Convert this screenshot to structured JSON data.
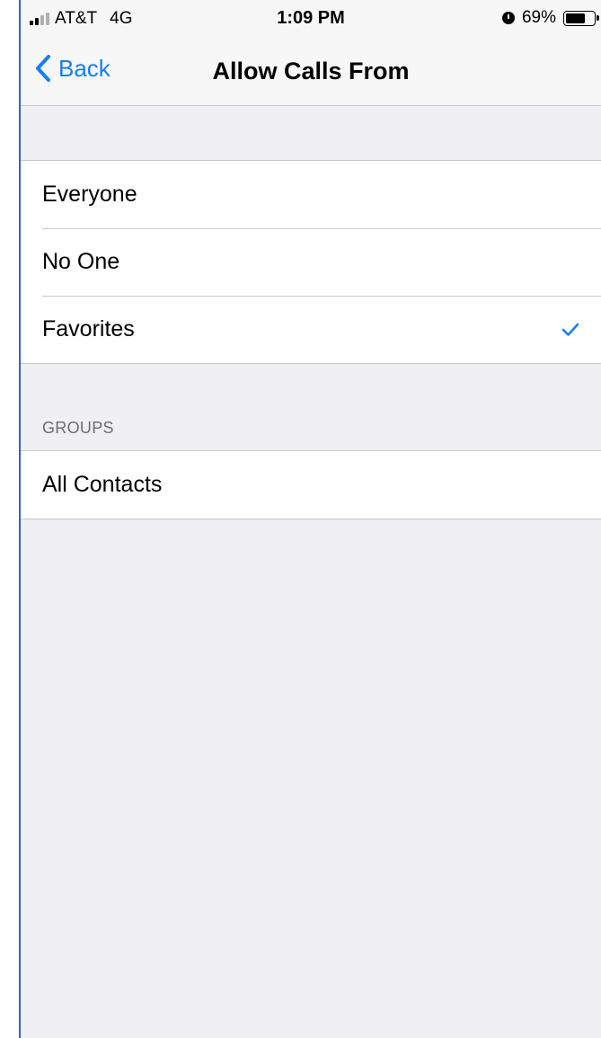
{
  "status_bar": {
    "carrier": "AT&T",
    "network": "4G",
    "time": "1:09 PM",
    "battery_percent": "69%",
    "battery_level": 0.69
  },
  "nav": {
    "back_label": "Back",
    "title": "Allow Calls From"
  },
  "options": {
    "items": [
      {
        "label": "Everyone",
        "selected": false
      },
      {
        "label": "No One",
        "selected": false
      },
      {
        "label": "Favorites",
        "selected": true
      }
    ]
  },
  "groups": {
    "header": "GROUPS",
    "items": [
      {
        "label": "All Contacts"
      }
    ]
  },
  "colors": {
    "accent": "#157efb",
    "background": "#efeff4",
    "separator": "#c8c7cc",
    "section_header": "#6d6d72"
  },
  "icons": {
    "back": "chevron-left-icon",
    "selected": "checkmark-icon",
    "alarm": "alarm-icon",
    "battery": "battery-icon",
    "signal": "signal-icon"
  }
}
